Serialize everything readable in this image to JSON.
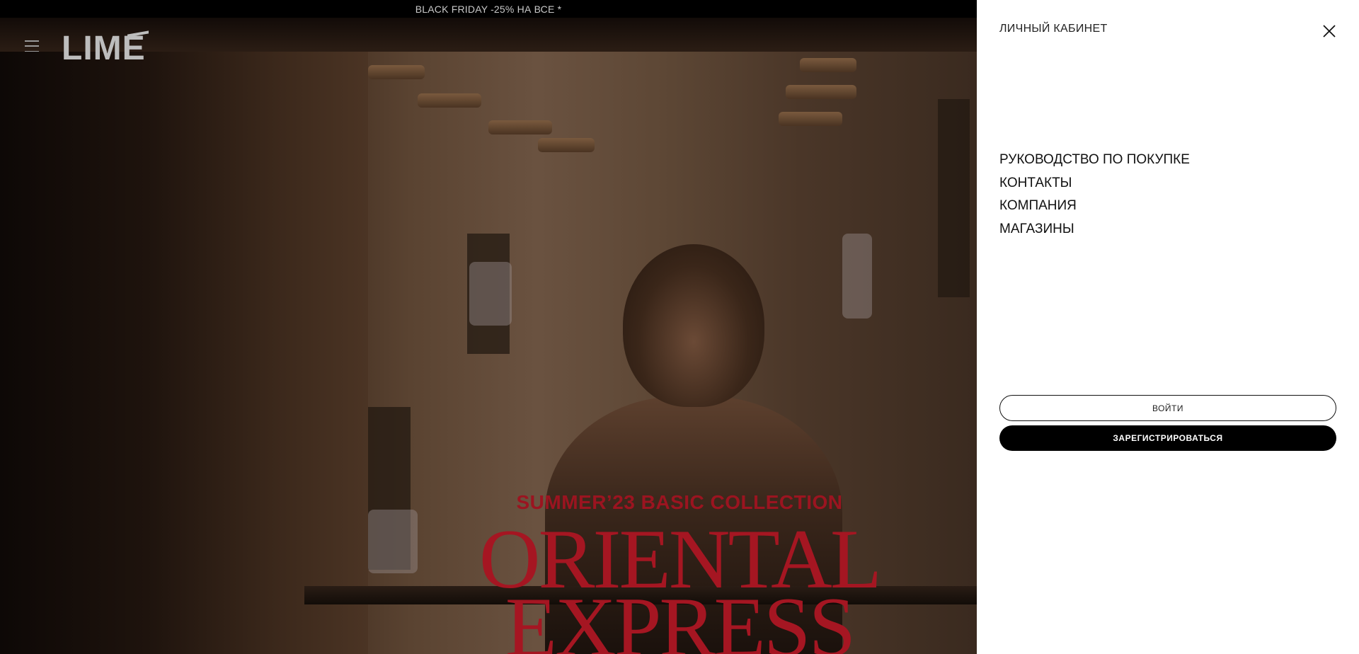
{
  "promo": {
    "text": "BLACK FRIDAY -25% НА ВСЕ *"
  },
  "header": {
    "logo_text": "LIME"
  },
  "hero": {
    "subtitle": "SUMMER’23 BASIC COLLECTION",
    "title_line1": "ORIENTAL",
    "title_line2": "EXPRESS"
  },
  "panel": {
    "title": "ЛИЧНЫЙ КАБИНЕТ",
    "nav": [
      {
        "label": "РУКОВОДСТВО ПО ПОКУПКЕ"
      },
      {
        "label": "КОНТАКТЫ"
      },
      {
        "label": "КОМПАНИЯ"
      },
      {
        "label": "МАГАЗИНЫ"
      }
    ],
    "login_label": "ВОЙТИ",
    "register_label": "ЗАРЕГИСТРИРОВАТЬСЯ"
  },
  "colors": {
    "accent_red": "#a51622",
    "panel_bg": "#ffffff",
    "promo_bg": "#000000"
  },
  "icons": {
    "menu": "hamburger-icon",
    "close": "close-icon"
  }
}
